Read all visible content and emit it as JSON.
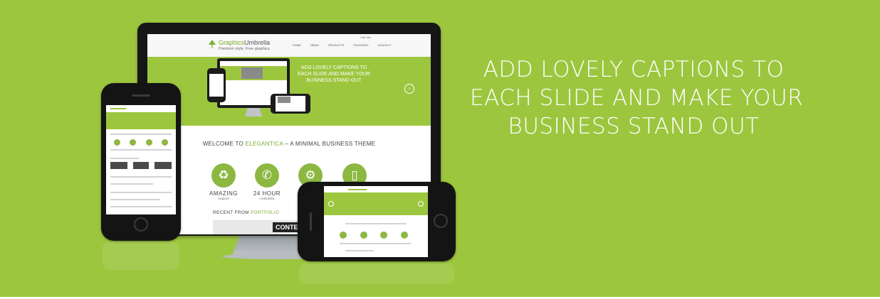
{
  "caption": {
    "lines": [
      "ADD LOVELY CAPTIONS TO",
      "EACH SLIDE AND MAKE YOUR",
      "BUSINESS STAND OUT"
    ]
  },
  "monitor_site": {
    "logo_word1": "Graphics",
    "logo_word2": "Umbrella",
    "logo_tagline": "Premium style. Free graphics",
    "top_link": "Visit Info",
    "nav": [
      "HOME",
      "NEWS",
      "PRODUCTS",
      "FEATURES",
      "CONTACT"
    ],
    "hero_caption": "ADD LOVELY CAPTIONS TO EACH SLIDE AND MAKE YOUR BUSINESS STAND OUT",
    "welcome_prefix": "WELCOME TO ",
    "welcome_brand": "ELEGANTICA",
    "welcome_suffix": " – A MINIMAL BUSINESS THEME",
    "features": [
      {
        "icon": "recycle-icon",
        "glyph": "♻",
        "title": "AMAZING",
        "subtitle": "Support"
      },
      {
        "icon": "phone-icon",
        "glyph": "✆",
        "title": "24 HOUR",
        "subtitle": "Availability"
      },
      {
        "icon": "gear-icon",
        "glyph": "⚙",
        "title": "",
        "subtitle": ""
      },
      {
        "icon": "mobile-icon",
        "glyph": "▯",
        "title": "",
        "subtitle": ""
      }
    ],
    "recent_prefix": "RECENT FROM ",
    "recent_accent": "PORTFOLIO",
    "content_label": "CONTEMI"
  },
  "colors": {
    "background": "#9dc63f",
    "accent": "#7dae2e",
    "device": "#141414"
  }
}
